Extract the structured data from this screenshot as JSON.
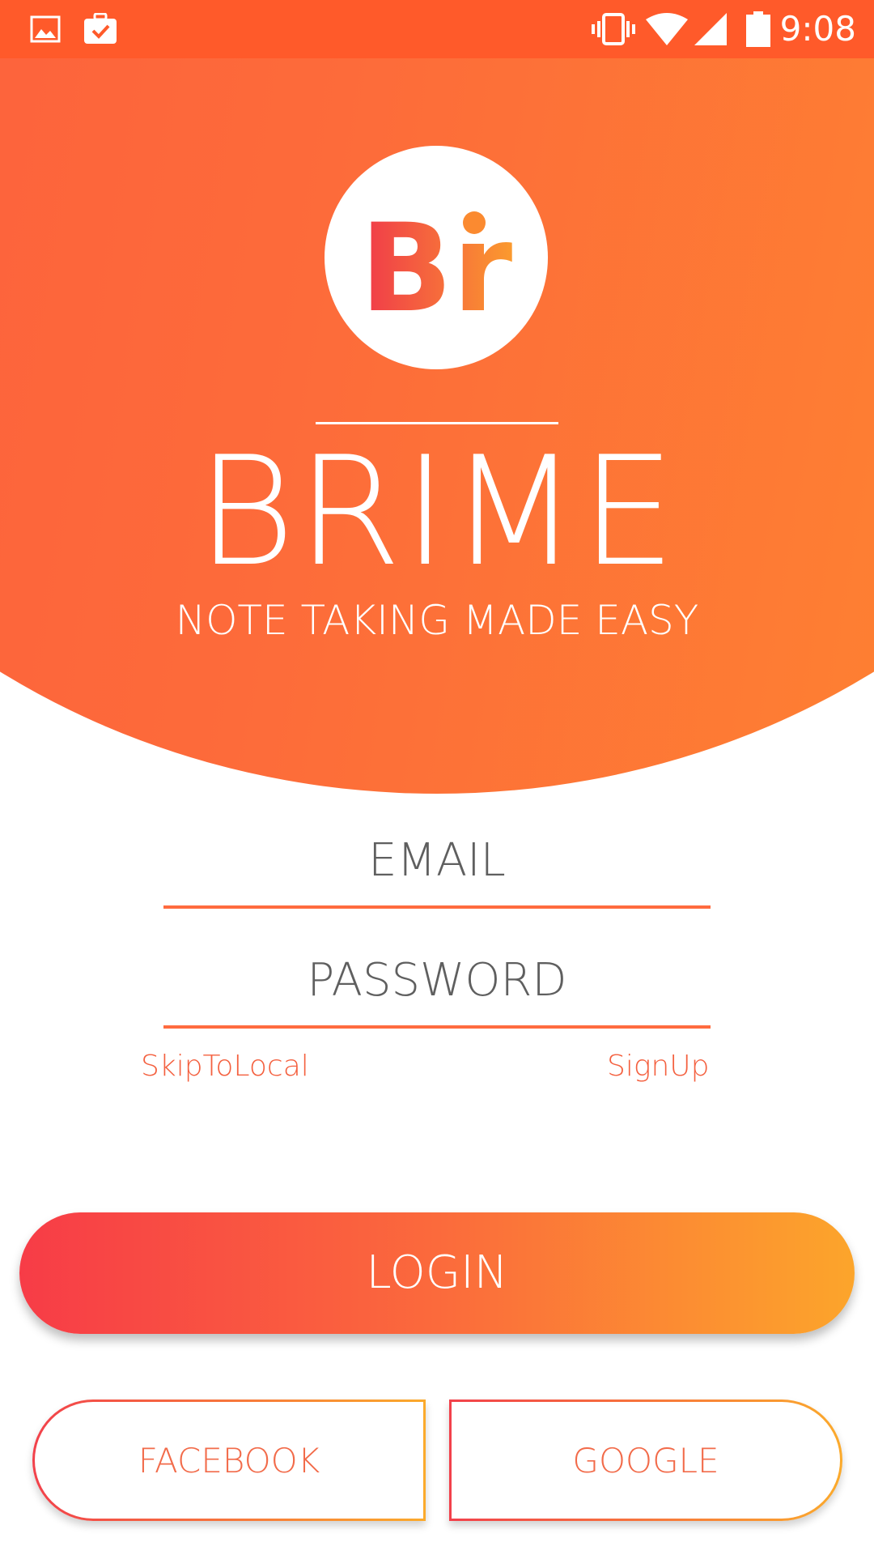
{
  "status_bar": {
    "time": "9:08",
    "icons": [
      "image-icon",
      "briefcase-check-icon",
      "vibrate-icon",
      "wifi-icon",
      "signal-icon",
      "battery-icon"
    ]
  },
  "hero": {
    "logo_text": "Br",
    "title": "BRIME",
    "subtitle": "NOTE TAKING MADE EASY"
  },
  "form": {
    "email_placeholder": "EMAIL",
    "password_placeholder": "PASSWORD",
    "skip_link": "SkipToLocal",
    "signup_link": "SignUp"
  },
  "buttons": {
    "login": "LOGIN",
    "facebook": "FACEBOOK",
    "google": "GOOGLE"
  },
  "colors": {
    "status_bar": "#ff5a2a",
    "hero_start": "#fd5a3e",
    "hero_end": "#fe8a2e",
    "accent": "#f4603f",
    "login_start": "#f73c47",
    "login_end": "#fca52b"
  }
}
